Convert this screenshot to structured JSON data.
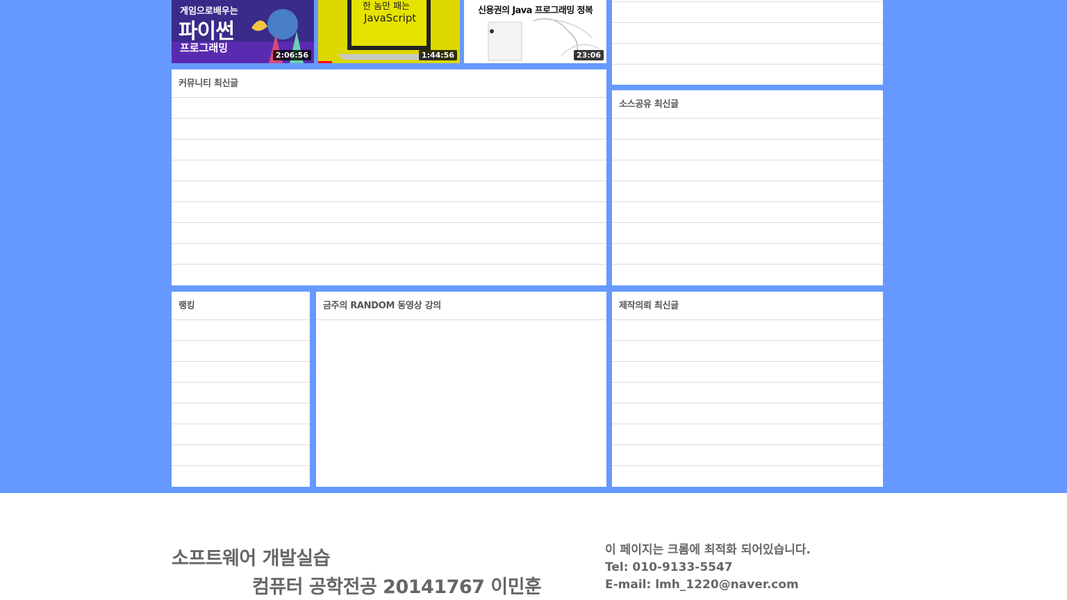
{
  "videos": [
    {
      "title_top": "게임으로배우는",
      "title_main": "파이썬",
      "title_bottom": "프로그래밍",
      "duration": "2:06:56"
    },
    {
      "title_top": "한 놈만 패는",
      "title_main": "JavaScript",
      "duration": "1:44:56"
    },
    {
      "title_top": "신용권의 Java 프로그래밍 정복",
      "duration": "23:06"
    }
  ],
  "panels": {
    "community": {
      "title": "커뮤니티 최신글"
    },
    "source": {
      "title": "소스공유 최신글"
    },
    "ranking": {
      "title": "랭킹"
    },
    "random_video": {
      "title": "금주의 RANDOM 동영상 강의"
    },
    "request": {
      "title": "제작의뢰 최신글"
    }
  },
  "footer": {
    "title": "소프트웨어 개발실습",
    "subtitle": "컴퓨터 공학전공 20141767 이민훈",
    "notice": "이 페이지는 크롬에 최적화 되어있습니다.",
    "tel": "Tel: 010-9133-5547",
    "email": "E-mail: lmh_1220@naver.com"
  },
  "colors": {
    "background_blue": "#6699ff",
    "panel_white": "#ffffff",
    "divider": "#dddddd"
  }
}
